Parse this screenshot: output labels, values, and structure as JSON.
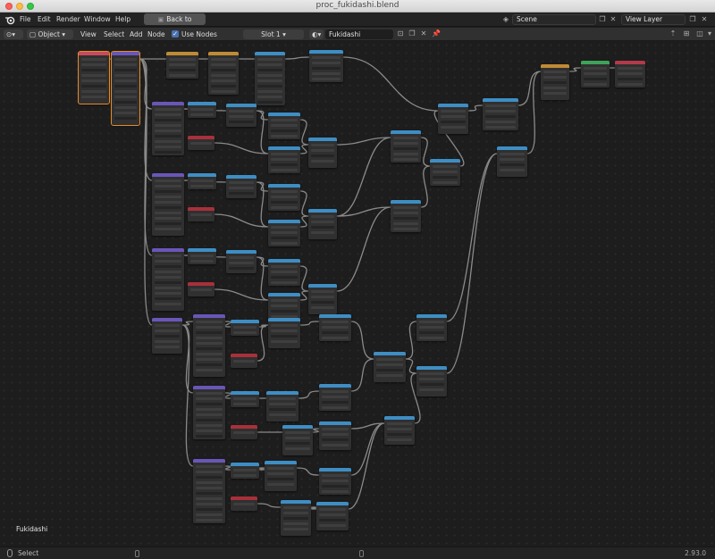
{
  "window": {
    "title": "proc_fukidashi.blend"
  },
  "menubar": {
    "items": [
      "File",
      "Edit",
      "Render",
      "Window",
      "Help"
    ],
    "back_button": "Back to Previous",
    "scene_field": "Scene",
    "view_layer_field": "View Layer"
  },
  "editor_header": {
    "object_mode": "Object",
    "menus": [
      "View",
      "Select",
      "Add",
      "Node"
    ],
    "use_nodes_label": "Use Nodes",
    "use_nodes_checked": true,
    "slot": "Slot 1",
    "material_name": "Fukidashi"
  },
  "canvas": {
    "context_label": "Fukidashi"
  },
  "statusbar": {
    "select_label": "Select",
    "version": "2.93.0"
  },
  "colors": {
    "input_header": "#c84a5a",
    "vector_header": "#6a56b8",
    "converter_header": "#3e8ec4",
    "color_header": "#c08b36",
    "shader_header": "#3ea35a",
    "output_header": "#b33a4a",
    "value_header": "#a8303a",
    "wire": "#8a8a8a",
    "accent_selected": "#e58c2b"
  }
}
